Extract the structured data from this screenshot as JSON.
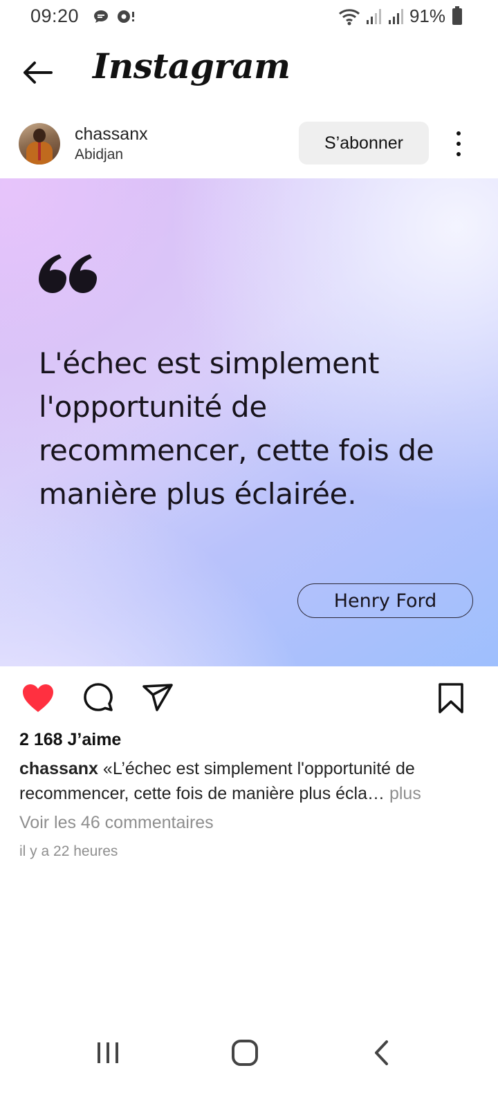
{
  "status_bar": {
    "time": "09:20",
    "battery": "91%"
  },
  "header": {
    "title": "Instagram"
  },
  "post": {
    "username": "chassanx",
    "location": "Abidjan",
    "subscribe_label": "S’abonner",
    "quote": "L'échec est simplement l'opportunité de recommencer, cette fois de manière plus éclairée.",
    "author": "Henry Ford",
    "likes": "2 168 J’aime",
    "caption_user": "chassanx",
    "caption_text": " «L’échec est simplement l'opportunité de recommencer, cette fois de manière plus écla…",
    "caption_more": " plus",
    "comments_link": "Voir les 46 commentaires",
    "time_ago": "il y a 22 heures",
    "liked": true
  },
  "colors": {
    "like_red": "#ff3040",
    "muted_text": "#8e8e8e",
    "button_bg": "#efefef"
  },
  "icons": [
    "back-arrow-icon",
    "like-heart-icon",
    "comment-icon",
    "share-icon",
    "bookmark-icon",
    "more-icon",
    "recents-icon",
    "home-icon",
    "nav-back-icon"
  ]
}
